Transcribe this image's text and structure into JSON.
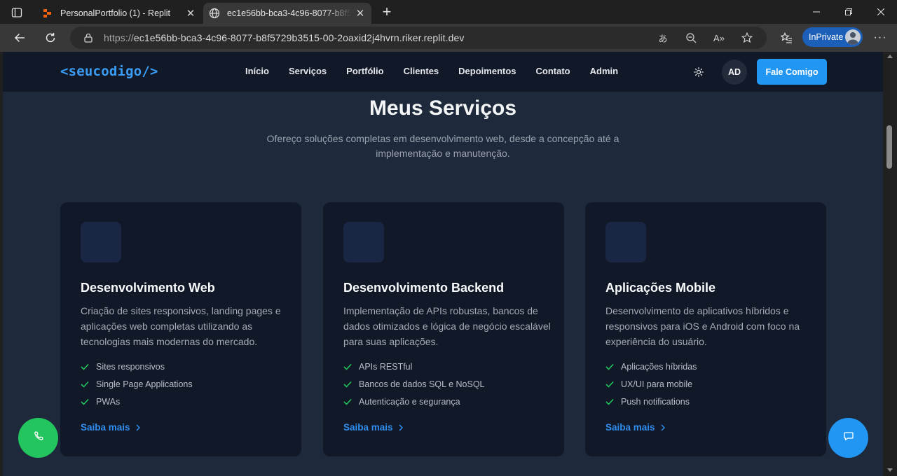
{
  "browser": {
    "tabs": [
      {
        "title": "PersonalPortfolio (1) - Replit",
        "active": false,
        "favicon": "replit-icon"
      },
      {
        "title": "ec1e56bb-bca3-4c96-8077-b8f5729b3515-00-2oaxid2j4hvrn.riker.replit.dev",
        "active": true,
        "favicon": "globe-icon"
      }
    ],
    "address": {
      "scheme": "https://",
      "host": "ec1e56bb-bca3-4c96-8077-b8f5729b3515-00-2oaxid2j4hvrn.riker.replit.dev"
    },
    "inprivate_label": "InPrivate"
  },
  "site": {
    "logo": "<seucodigo/>",
    "nav": [
      "Início",
      "Serviços",
      "Portfólio",
      "Clientes",
      "Depoimentos",
      "Contato",
      "Admin"
    ],
    "user_initials": "AD",
    "cta_label": "Fale Comigo",
    "colors": {
      "accent": "#2196f3",
      "page_bg": "#1e293b",
      "card_bg": "#111827",
      "check": "#22c55e",
      "whatsapp": "#22c55e"
    }
  },
  "services": {
    "title": "Meus Serviços",
    "subtitle": "Ofereço soluções completas em desenvolvimento web, desde a concepção até a implementação e manutenção.",
    "cards": [
      {
        "title": "Desenvolvimento Web",
        "description": "Criação de sites responsivos, landing pages e aplicações web completas utilizando as tecnologias mais modernas do mercado.",
        "features": [
          "Sites responsivos",
          "Single Page Applications",
          "PWAs"
        ],
        "link": "Saiba mais"
      },
      {
        "title": "Desenvolvimento Backend",
        "description": "Implementação de APIs robustas, bancos de dados otimizados e lógica de negócio escalável para suas aplicações.",
        "features": [
          "APIs RESTful",
          "Bancos de dados SQL e NoSQL",
          "Autenticação e segurança"
        ],
        "link": "Saiba mais"
      },
      {
        "title": "Aplicações Mobile",
        "description": "Desenvolvimento de aplicativos híbridos e responsivos para iOS e Android com foco na experiência do usuário.",
        "features": [
          "Aplicações híbridas",
          "UX/UI para mobile",
          "Push notifications"
        ],
        "link": "Saiba mais"
      }
    ]
  }
}
